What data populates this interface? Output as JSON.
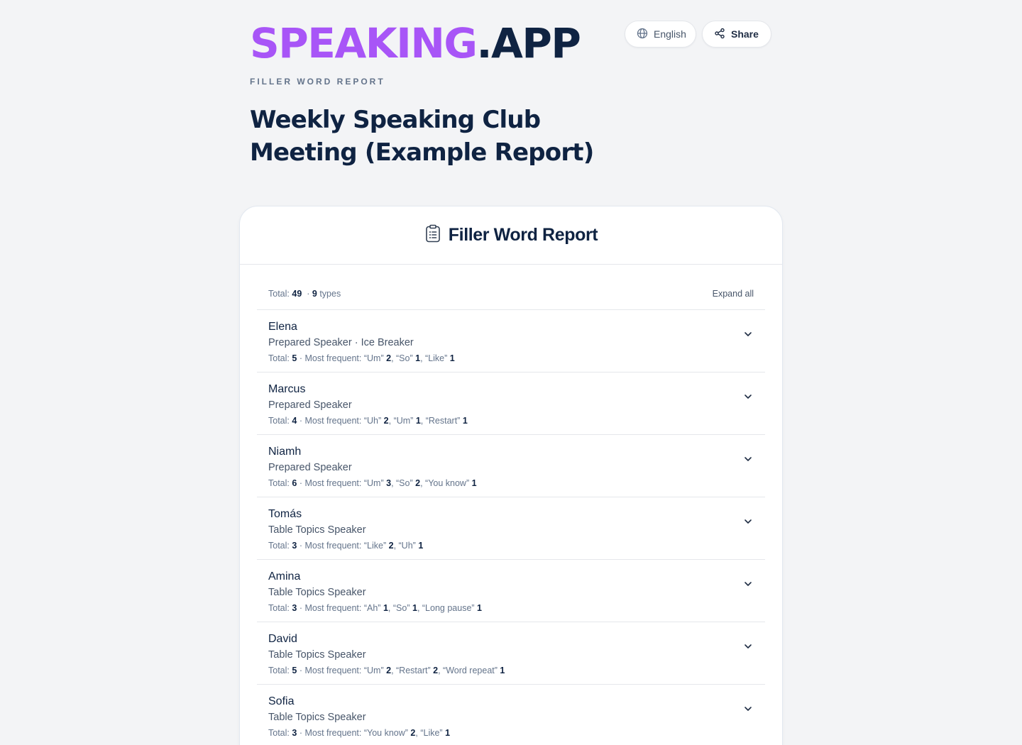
{
  "brand": {
    "part1": "SPEAKING",
    "part2": ".",
    "part3": "APP",
    "accent_color": "#a855f7",
    "dark_color": "#0f2342"
  },
  "eyebrow": "FILLER WORD REPORT",
  "report_title": "Weekly Speaking Club Meeting (Example Report)",
  "header_actions": {
    "language_label": "English",
    "language_icon": "globe-icon",
    "share_label": "Share",
    "share_icon": "share-icon"
  },
  "card": {
    "title": "Filler Word Report",
    "title_icon": "clipboard-icon",
    "summary": {
      "total_label": "Total:",
      "total_value": "49",
      "separator": "·",
      "types_value": "9",
      "types_label": "types",
      "expand_all_label": "Expand all"
    },
    "speakers": [
      {
        "name": "Elena",
        "role": "Prepared Speaker · Ice Breaker",
        "total": "5",
        "frequent": [
          {
            "word": "“Um”",
            "count": "2"
          },
          {
            "word": "“So”",
            "count": "1"
          },
          {
            "word": "“Like”",
            "count": "1"
          }
        ]
      },
      {
        "name": "Marcus",
        "role": "Prepared Speaker",
        "total": "4",
        "frequent": [
          {
            "word": "“Uh”",
            "count": "2"
          },
          {
            "word": "“Um”",
            "count": "1"
          },
          {
            "word": "“Restart”",
            "count": "1"
          }
        ]
      },
      {
        "name": "Niamh",
        "role": "Prepared Speaker",
        "total": "6",
        "frequent": [
          {
            "word": "“Um”",
            "count": "3"
          },
          {
            "word": "“So”",
            "count": "2"
          },
          {
            "word": "“You know”",
            "count": "1"
          }
        ]
      },
      {
        "name": "Tomás",
        "role": "Table Topics Speaker",
        "total": "3",
        "frequent": [
          {
            "word": "“Like”",
            "count": "2"
          },
          {
            "word": "“Uh”",
            "count": "1"
          }
        ]
      },
      {
        "name": "Amina",
        "role": "Table Topics Speaker",
        "total": "3",
        "frequent": [
          {
            "word": "“Ah”",
            "count": "1"
          },
          {
            "word": "“So”",
            "count": "1"
          },
          {
            "word": "“Long pause”",
            "count": "1"
          }
        ]
      },
      {
        "name": "David",
        "role": "Table Topics Speaker",
        "total": "5",
        "frequent": [
          {
            "word": "“Um”",
            "count": "2"
          },
          {
            "word": "“Restart”",
            "count": "2"
          },
          {
            "word": "“Word repeat”",
            "count": "1"
          }
        ]
      },
      {
        "name": "Sofia",
        "role": "Table Topics Speaker",
        "total": "3",
        "frequent": [
          {
            "word": "“You know”",
            "count": "2"
          },
          {
            "word": "“Like”",
            "count": "1"
          }
        ]
      }
    ],
    "row_labels": {
      "total_label": "Total:",
      "dot": "·",
      "most_frequent_label": "Most frequent:",
      "chevron_icon": "chevron-down-icon"
    }
  }
}
